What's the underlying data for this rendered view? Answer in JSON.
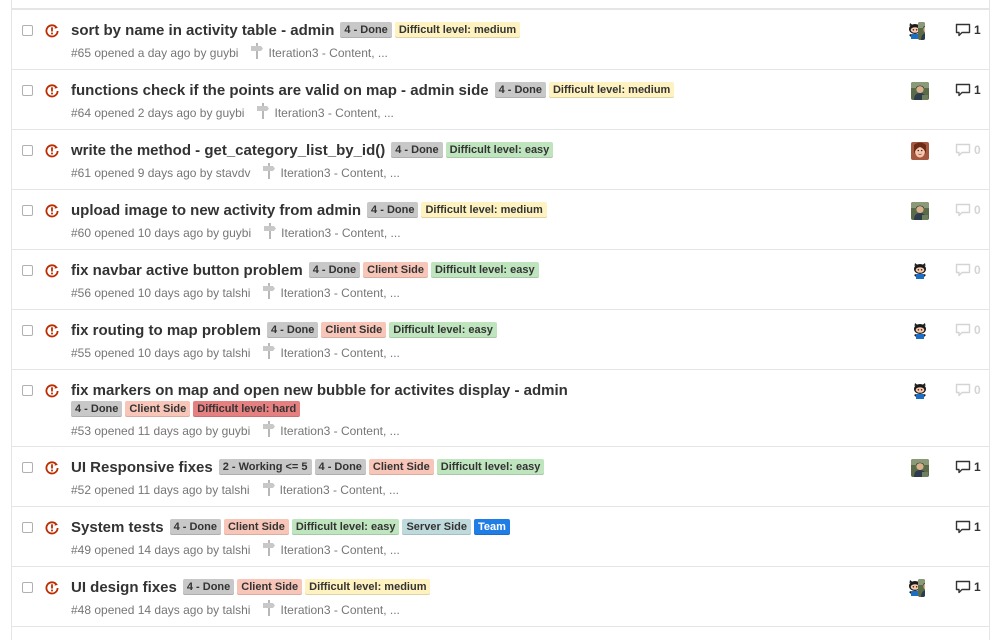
{
  "colors": {
    "open_icon": "#bd2c00",
    "done": "#c8c8c8",
    "working": "#c8c8c8",
    "client_side": "#f7c6b8",
    "easy": "#bfe5bf",
    "medium": "#fef2c0",
    "hard": "#e68080",
    "server_side": "#bfdadc",
    "team": "#207de5"
  },
  "issues": [
    {
      "title": "sort by name in activity table - admin",
      "labels": [
        {
          "text": "4 - Done",
          "kind": "done"
        },
        {
          "text": "Difficult level: medium",
          "kind": "medium"
        }
      ],
      "meta": "#65 opened a day ago by guybi",
      "milestone": "Iteration3 - Content, ...",
      "avatars": [
        "octocat-avatar",
        "person-avatar"
      ],
      "comments": "1"
    },
    {
      "title": "functions check if the points are valid on map - admin side",
      "labels": [
        {
          "text": "4 - Done",
          "kind": "done"
        },
        {
          "text": "Difficult level: medium",
          "kind": "medium"
        }
      ],
      "meta": "#64 opened 2 days ago by guybi",
      "milestone": "Iteration3 - Content, ...",
      "avatars": [
        "person-avatar"
      ],
      "comments": "1"
    },
    {
      "title": "write the method - get_category_list_by_id()",
      "labels": [
        {
          "text": "4 - Done",
          "kind": "done"
        },
        {
          "text": "Difficult level: easy",
          "kind": "easy"
        }
      ],
      "meta": "#61 opened 9 days ago by stavdv",
      "milestone": "Iteration3 - Content, ...",
      "avatars": [
        "woman-avatar"
      ],
      "comments": "0"
    },
    {
      "title": "upload image to new activity from admin",
      "labels": [
        {
          "text": "4 - Done",
          "kind": "done"
        },
        {
          "text": "Difficult level: medium",
          "kind": "medium"
        }
      ],
      "meta": "#60 opened 10 days ago by guybi",
      "milestone": "Iteration3 - Content, ...",
      "avatars": [
        "person-avatar"
      ],
      "comments": "0"
    },
    {
      "title": "fix navbar active button problem",
      "labels": [
        {
          "text": "4 - Done",
          "kind": "done"
        },
        {
          "text": "Client Side",
          "kind": "client_side"
        },
        {
          "text": "Difficult level: easy",
          "kind": "easy"
        }
      ],
      "meta": "#56 opened 10 days ago by talshi",
      "milestone": "Iteration3 - Content, ...",
      "avatars": [
        "octocat-avatar"
      ],
      "comments": "0"
    },
    {
      "title": "fix routing to map problem",
      "labels": [
        {
          "text": "4 - Done",
          "kind": "done"
        },
        {
          "text": "Client Side",
          "kind": "client_side"
        },
        {
          "text": "Difficult level: easy",
          "kind": "easy"
        }
      ],
      "meta": "#55 opened 10 days ago by talshi",
      "milestone": "Iteration3 - Content, ...",
      "avatars": [
        "octocat-avatar"
      ],
      "comments": "0"
    },
    {
      "title": "fix markers on map and open new bubble for activites display - admin",
      "labels": [
        {
          "text": "4 - Done",
          "kind": "done"
        },
        {
          "text": "Client Side",
          "kind": "client_side"
        },
        {
          "text": "Difficult level: hard",
          "kind": "hard"
        }
      ],
      "meta": "#53 opened 11 days ago by guybi",
      "milestone": "Iteration3 - Content, ...",
      "avatars": [
        "octocat-avatar"
      ],
      "comments": "0"
    },
    {
      "title": "UI Responsive fixes",
      "labels": [
        {
          "text": "2 - Working <= 5",
          "kind": "working"
        },
        {
          "text": "4 - Done",
          "kind": "done"
        },
        {
          "text": "Client Side",
          "kind": "client_side"
        },
        {
          "text": "Difficult level: easy",
          "kind": "easy"
        }
      ],
      "meta": "#52 opened 11 days ago by talshi",
      "milestone": "Iteration3 - Content, ...",
      "avatars": [
        "person-avatar"
      ],
      "comments": "1"
    },
    {
      "title": "System tests",
      "labels": [
        {
          "text": "4 - Done",
          "kind": "done"
        },
        {
          "text": "Client Side",
          "kind": "client_side"
        },
        {
          "text": "Difficult level: easy",
          "kind": "easy"
        },
        {
          "text": "Server Side",
          "kind": "server_side"
        },
        {
          "text": "Team",
          "kind": "team"
        }
      ],
      "meta": "#49 opened 14 days ago by talshi",
      "milestone": "Iteration3 - Content, ...",
      "avatars": [],
      "comments": "1"
    },
    {
      "title": "UI design fixes",
      "labels": [
        {
          "text": "4 - Done",
          "kind": "done"
        },
        {
          "text": "Client Side",
          "kind": "client_side"
        },
        {
          "text": "Difficult level: medium",
          "kind": "medium"
        }
      ],
      "meta": "#48 opened 14 days ago by talshi",
      "milestone": "Iteration3 - Content, ...",
      "avatars": [
        "octocat-avatar",
        "person-avatar"
      ],
      "comments": "1"
    }
  ]
}
